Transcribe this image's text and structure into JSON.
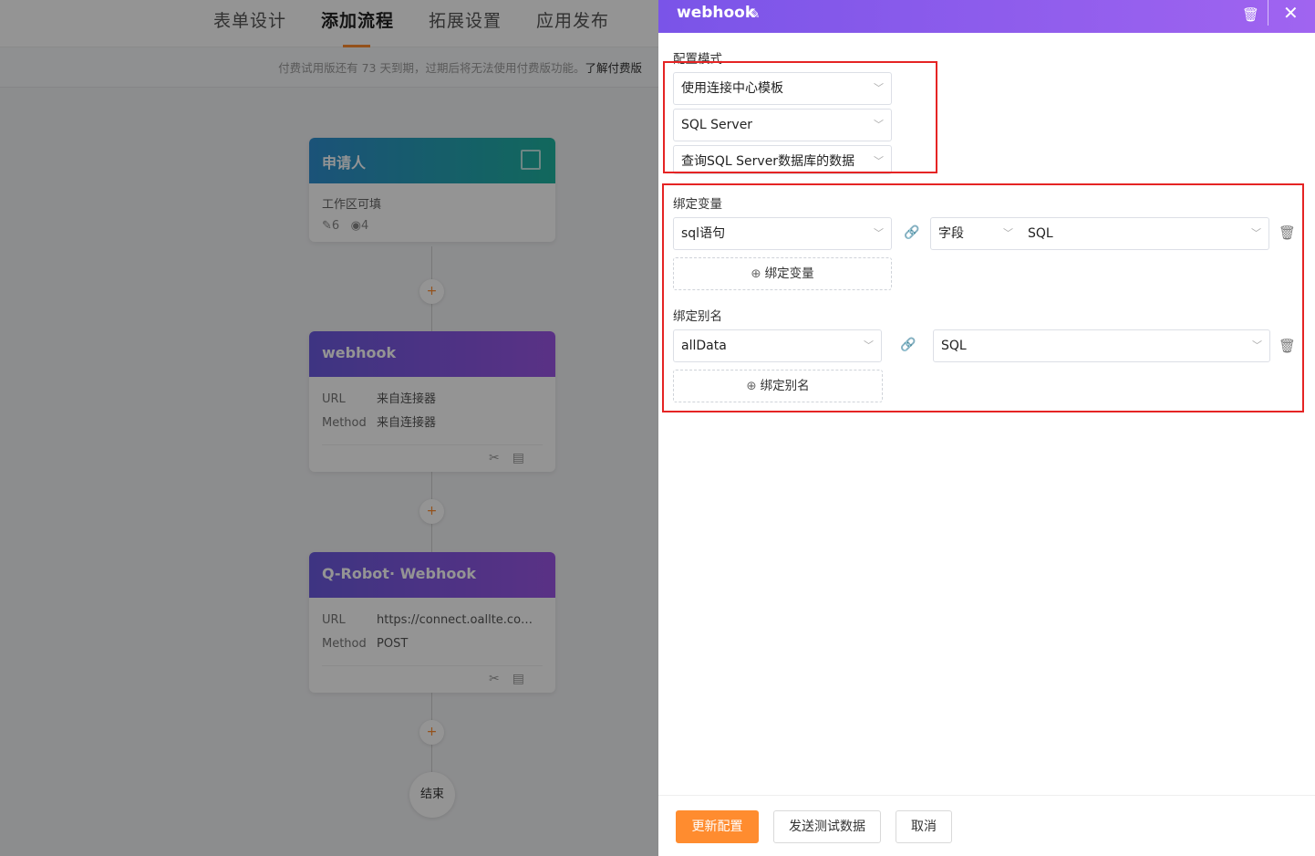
{
  "nav": {
    "tabs": [
      "表单设计",
      "添加流程",
      "拓展设置",
      "应用发布"
    ],
    "trial_text": "付费试用版还有 73 天到期，过期后将无法使用付费版功能。",
    "trial_link": "了解付费版"
  },
  "flow": {
    "applicant": {
      "title": "申请人",
      "desc": "工作区可填",
      "edit_count": "6",
      "view_count": "4"
    },
    "webhook": {
      "title": "webhook",
      "url_label": "URL",
      "url_value": "来自连接器",
      "method_label": "Method",
      "method_value": "来自连接器"
    },
    "qrobot": {
      "title": "Q-Robot· Webhook",
      "url_label": "URL",
      "url_value": "https://connect.oallte.com···",
      "method_label": "Method",
      "method_value": "POST"
    },
    "plus": "+",
    "end": "结束"
  },
  "drawer": {
    "title": "webhook",
    "config_mode_label": "配置模式",
    "mode_select": "使用连接中心模板",
    "db_select": "SQL Server",
    "action_select": "查询SQL Server数据库的数据",
    "bind_var_label": "绑定变量",
    "var_name": "sql语句",
    "var_source_type": "字段",
    "var_source_value": "SQL",
    "add_var_button": "绑定变量",
    "bind_alias_label": "绑定别名",
    "alias_name": "allData",
    "alias_value": "SQL",
    "add_alias_button": "绑定别名",
    "buttons": {
      "update": "更新配置",
      "send_test": "发送测试数据",
      "cancel": "取消"
    }
  },
  "colors": {
    "accent": "#ff8c2f",
    "drawer_header": "#8a5cec",
    "highlight": "#e52424"
  },
  "icons": [
    "edit-icon",
    "trash-icon",
    "close-icon",
    "chevron-down-icon",
    "link-icon",
    "plus-circle-icon",
    "scissors-icon",
    "copy-icon",
    "pencil-icon",
    "eye-icon"
  ]
}
